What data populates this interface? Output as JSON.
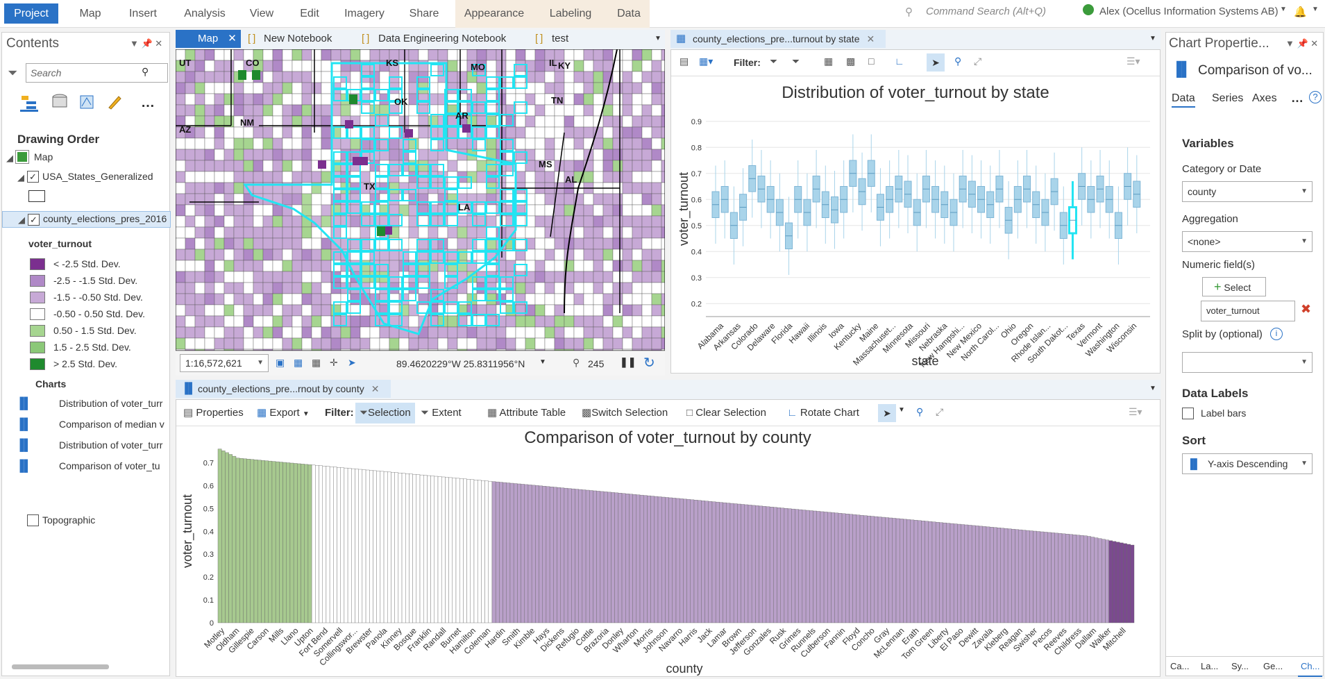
{
  "ribbon": {
    "tabs": [
      "Project",
      "Map",
      "Insert",
      "Analysis",
      "View",
      "Edit",
      "Imagery",
      "Share",
      "Appearance",
      "Labeling",
      "Data"
    ],
    "command_search": "Command Search (Alt+Q)",
    "user": "Alex (Ocellus Information Systems AB)"
  },
  "contents": {
    "title": "Contents",
    "search_placeholder": "Search",
    "drawing_order": "Drawing Order",
    "map": "Map",
    "layer1": "USA_States_Generalized",
    "layer2": "county_elections_pres_2016",
    "field": "voter_turnout",
    "legend": [
      {
        "label": "< -2.5 Std. Dev.",
        "color": "#7b2f8f"
      },
      {
        "label": "-2.5 - -1.5 Std. Dev.",
        "color": "#b089c7"
      },
      {
        "label": "-1.5 - -0.50 Std. Dev.",
        "color": "#c7a9d6"
      },
      {
        "label": "-0.50 - 0.50 Std. Dev.",
        "color": "#ffffff"
      },
      {
        "label": "0.50 - 1.5 Std. Dev.",
        "color": "#a6d590"
      },
      {
        "label": "1.5 - 2.5 Std. Dev.",
        "color": "#8bc878"
      },
      {
        "label": "> 2.5 Std. Dev.",
        "color": "#1f8a2e"
      }
    ],
    "charts_heading": "Charts",
    "charts": [
      "Distribution of voter_turr",
      "Comparison of median v",
      "Distribution of voter_turr",
      "Comparison of  voter_tu"
    ],
    "topographic": "Topographic"
  },
  "map_tabs": [
    "Map",
    "New Notebook",
    "Data Engineering Notebook",
    "test"
  ],
  "map": {
    "labels": [
      "UT",
      "CO",
      "KS",
      "MO",
      "IL",
      "KY",
      "AZ",
      "NM",
      "OK",
      "AR",
      "TN",
      "TX",
      "MS",
      "AL",
      "LA"
    ],
    "scale": "1:16,572,621",
    "coords": "89.4620229°W 25.8311956°N",
    "selected_count": "245"
  },
  "boxchart": {
    "tab": "county_elections_pre...turnout by state",
    "filter_label": "Filter:",
    "title": "Distribution of voter_turnout by state",
    "xlabel": "state",
    "ylabel": "voter_turnout"
  },
  "barchart": {
    "tab": "county_elections_pre...rnout by county",
    "toolbar": {
      "properties": "Properties",
      "export": "Export",
      "filter": "Filter:",
      "selection": "Selection",
      "extent": "Extent",
      "attribute_table": "Attribute Table",
      "switch_selection": "Switch Selection",
      "clear_selection": "Clear Selection",
      "rotate_chart": "Rotate Chart"
    },
    "title": "Comparison of voter_turnout by county",
    "xlabel": "county",
    "ylabel": "voter_turnout"
  },
  "props": {
    "title": "Chart Propertie...",
    "chart_name": "Comparison of  vo...",
    "tabs": [
      "Data",
      "Series",
      "Axes"
    ],
    "variables": "Variables",
    "category_label": "Category or Date",
    "category_value": "county",
    "aggregation_label": "Aggregation",
    "aggregation_value": "<none>",
    "numeric_label": "Numeric field(s)",
    "select_btn": "Select",
    "numeric_value": "voter_turnout",
    "split_label": "Split by (optional)",
    "data_labels": "Data Labels",
    "label_bars": "Label bars",
    "sort": "Sort",
    "sort_value": "Y-axis Descending",
    "bottom_tabs": [
      "Ca...",
      "La...",
      "Sy...",
      "Ge...",
      "Ch..."
    ]
  },
  "colors": {
    "accent": "#2a72c6",
    "box": "#a9d4ea",
    "box_selected": "#22e4f2",
    "bar_green": "#a7c98f",
    "bar_white": "#ffffff",
    "bar_purple": "#b9a0c9",
    "bar_dark": "#7b4a8f"
  },
  "chart_data": [
    {
      "type": "box",
      "title": "Distribution of voter_turnout by state",
      "xlabel": "state",
      "ylabel": "voter_turnout",
      "ylim": [
        0.15,
        0.95
      ],
      "yticks": [
        0.2,
        0.3,
        0.4,
        0.5,
        0.6,
        0.7,
        0.8,
        0.9
      ],
      "tick_labels": [
        "Alabama",
        "Arkansas",
        "Colorado",
        "Delaware",
        "Florida",
        "Hawaii",
        "Illinois",
        "Iowa",
        "Kentucky",
        "Maine",
        "Massachuset...",
        "Minnesota",
        "Missouri",
        "Nebraska",
        "New Hampshi...",
        "New Mexico",
        "North Carol...",
        "Ohio",
        "Oregon",
        "Rhode Islan...",
        "South Dakot...",
        "Texas",
        "Vermont",
        "Washington",
        "Wisconsin"
      ],
      "medians": [
        0.58,
        0.6,
        0.5,
        0.57,
        0.68,
        0.64,
        0.6,
        0.55,
        0.46,
        0.6,
        0.55,
        0.64,
        0.58,
        0.56,
        0.6,
        0.7,
        0.63,
        0.7,
        0.57,
        0.6,
        0.64,
        0.62,
        0.55,
        0.64,
        0.6,
        0.58,
        0.55,
        0.64,
        0.62,
        0.6,
        0.58,
        0.64,
        0.52,
        0.6,
        0.64,
        0.58,
        0.55,
        0.63,
        0.5,
        0.52,
        0.65,
        0.6,
        0.64,
        0.6,
        0.5,
        0.65,
        0.62
      ]
    },
    {
      "type": "bar",
      "title": "Comparison of voter_turnout by county",
      "xlabel": "county",
      "ylabel": "voter_turnout",
      "ylim": [
        0,
        0.75
      ],
      "yticks": [
        0,
        0.1,
        0.2,
        0.3,
        0.4,
        0.5,
        0.6,
        0.7
      ],
      "tick_labels": [
        "Motley",
        "Oldham",
        "Gillespie",
        "Carson",
        "Mills",
        "Llano",
        "Upton",
        "Fort Bend",
        "Somervell",
        "Collingswor...",
        "Brewster",
        "Panola",
        "Kinney",
        "Bosque",
        "Franklin",
        "Randall",
        "Burnet",
        "Hamilton",
        "Coleman",
        "Hardin",
        "Smith",
        "Kimble",
        "Hays",
        "Dickens",
        "Refugio",
        "Cottle",
        "Brazoria",
        "Donley",
        "Wharton",
        "Morris",
        "Johnson",
        "Navarro",
        "Harris",
        "Jack",
        "Lamar",
        "Brown",
        "Jefferson",
        "Gonzales",
        "Rusk",
        "Grimes",
        "Runnels",
        "Culberson",
        "Fannin",
        "Floyd",
        "Concho",
        "Gray",
        "McLennan",
        "Erath",
        "Tom Green",
        "Liberty",
        "El Paso",
        "Dewitt",
        "Zavala",
        "Kleberg",
        "Reagan",
        "Swisher",
        "Pecos",
        "Reeves",
        "Childress",
        "Dallam",
        "Walker",
        "Mitchell"
      ],
      "bar_count": 254,
      "max": 0.76,
      "min": 0.34
    }
  ]
}
